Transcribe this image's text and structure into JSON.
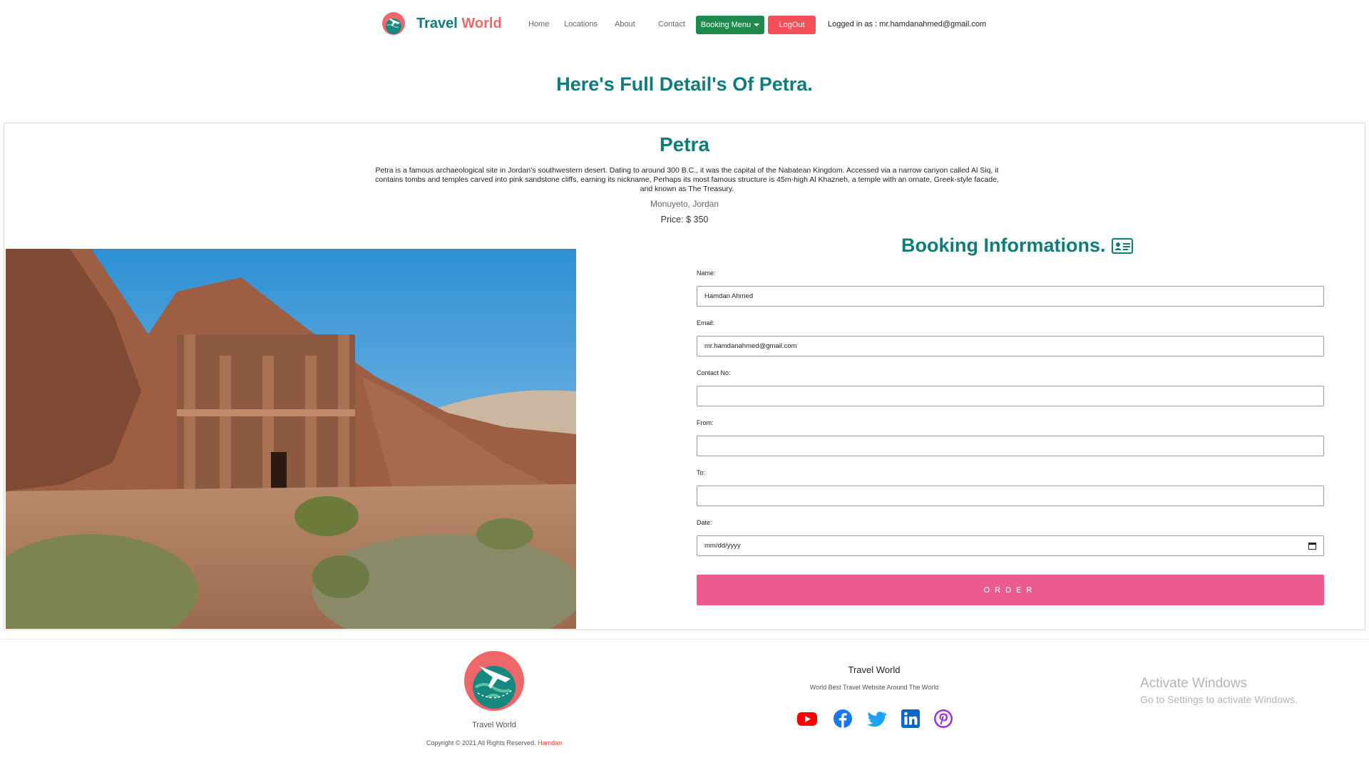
{
  "brand": {
    "word1": "Travel",
    "word2": "World"
  },
  "nav": {
    "home": "Home",
    "locations": "Locations",
    "about": "About",
    "contact": "Contact",
    "booking_menu": "Booking Menu",
    "logout": "LogOut",
    "logged_in": "Logged in as : mr.hamdanahmed@gmail.com"
  },
  "page": {
    "heading": "Here's Full Detail's Of Petra."
  },
  "place": {
    "title": "Petra",
    "description": "Petra is a famous archaeological site in Jordan's southwestern desert. Dating to around 300 B.C., it was the capital of the Nabatean Kingdom. Accessed via a narrow canyon called Al Siq, it contains tombs and temples carved into pink sandstone cliffs, earning its nickname, Perhaps its most famous structure is 45m-high Al Khazneh, a temple with an ornate, Greek-style facade, and known as The Treasury.",
    "location": "Monuyeto, Jordan",
    "price": "Price: $ 350"
  },
  "booking": {
    "heading": "Booking Informations.",
    "name_label": "Name:",
    "name_value": "Hamdan Ahmed",
    "email_label": "Email:",
    "email_value": "mr.hamdanahmed@gmail.com",
    "contact_label": "Contact No:",
    "contact_value": "",
    "from_label": "From:",
    "from_value": "",
    "to_label": "To:",
    "to_value": "",
    "date_label": "Date:",
    "date_placeholder": "mm/dd/yyyy",
    "order_label": "ORDER"
  },
  "footer": {
    "brand": "Travel World",
    "copyright": "Copyright © 2021 All Rights Reserved.",
    "author": "Hamdan",
    "title": "Travel World",
    "subtitle": "World Best Travel Website Around The World",
    "social": [
      "youtube-icon",
      "facebook-icon",
      "twitter-icon",
      "linkedin-icon",
      "pinterest-icon"
    ]
  },
  "watermark": {
    "title": "Activate Windows",
    "subtitle": "Go to Settings to activate Windows."
  },
  "colors": {
    "teal": "#0f7c7c",
    "coral": "#f0676a",
    "booking_green": "#1e8a4c",
    "logout_red": "#f5505a",
    "order_pink": "#ec5b8f"
  }
}
